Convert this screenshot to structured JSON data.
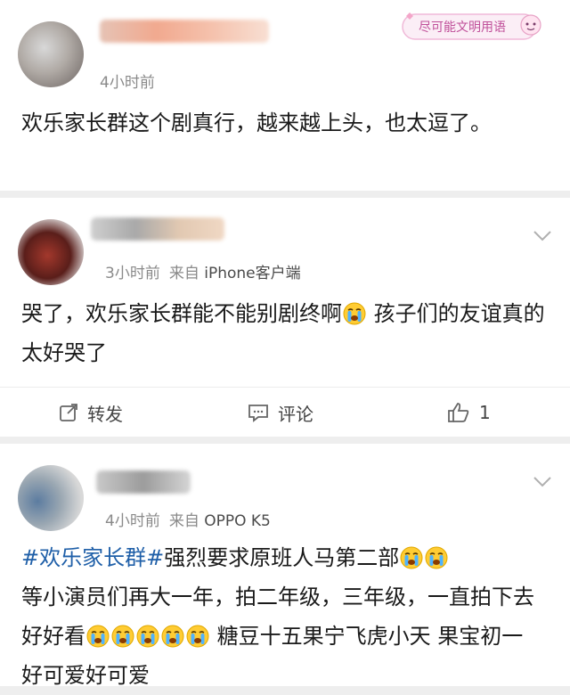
{
  "badge": {
    "text": "尽可能文明用语"
  },
  "comments": [
    {
      "time": "4小时前",
      "source_prefix": "",
      "device": "",
      "text": "欢乐家长群这个剧真行，越来越上头，也太逗了。"
    },
    {
      "time": "3小时前",
      "source_prefix": "来自",
      "device": "iPhone客户端",
      "text_part1": "哭了，欢乐家长群能不能别剧终啊",
      "text_part2": " 孩子们的友谊真的太好哭了",
      "actions": {
        "repost_label": "转发",
        "comment_label": "评论",
        "like_count": "1"
      }
    },
    {
      "time": "4小时前",
      "source_prefix": "来自",
      "device": "OPPO K5",
      "hashtag": "#欢乐家长群#",
      "text_part1": "强烈要求原班人马第二部",
      "text_part2": "等小演员们再大一年，拍二年级，三年级，一直拍下去 好好看",
      "text_part3": " 糖豆十五果宁飞虎小天 果宝初一 好可爱好可爱"
    }
  ],
  "icons": {
    "chevron": "chevron-down-icon",
    "repost": "repost-icon",
    "comment": "comment-icon",
    "like": "thumbs-up-icon",
    "emoji": "crying-face-emoji"
  },
  "colors": {
    "hashtag": "#1f5fa8",
    "meta": "#8a8a8a",
    "divider": "#eeeeee"
  }
}
